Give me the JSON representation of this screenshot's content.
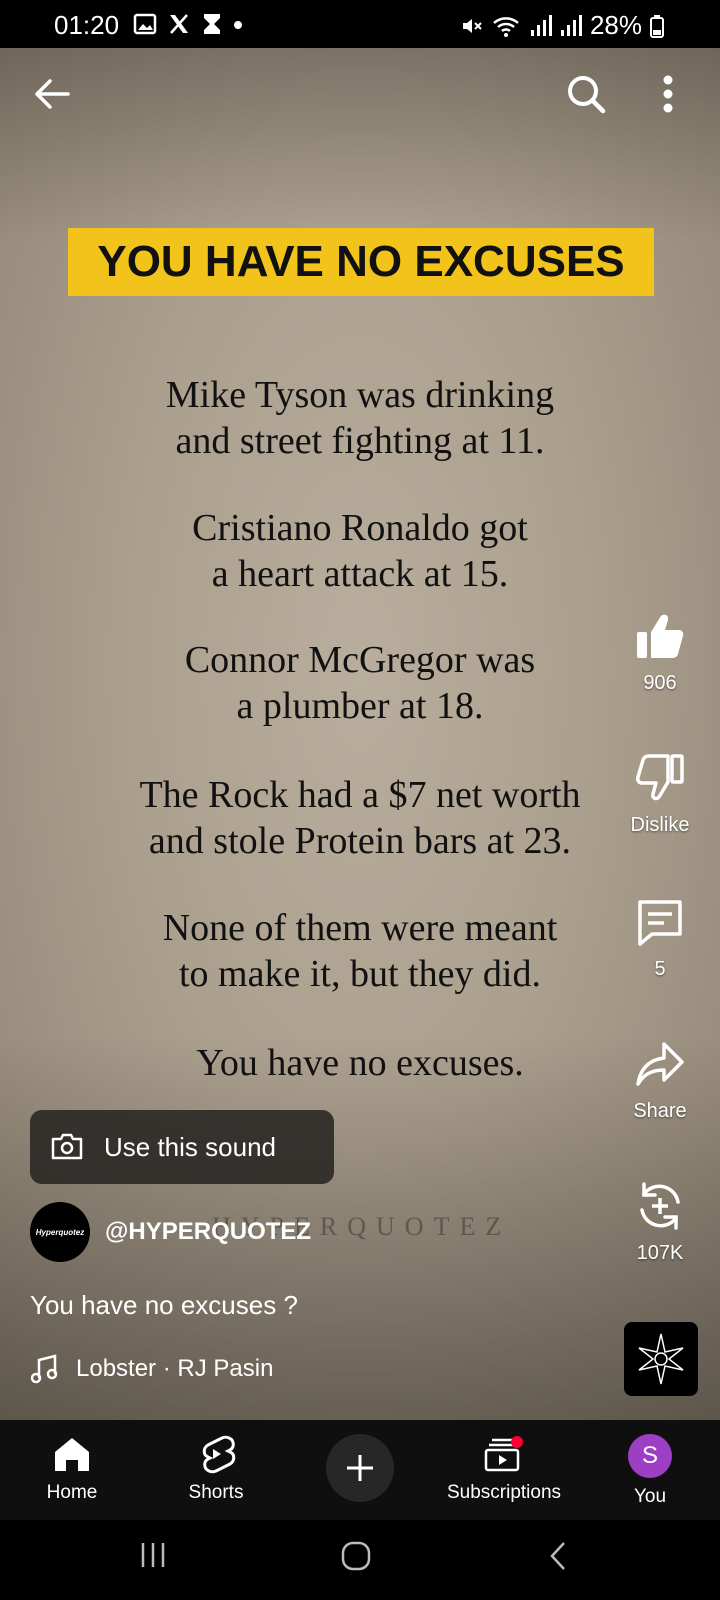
{
  "status_bar": {
    "time": "01:20",
    "battery": "28%"
  },
  "video": {
    "headline": "YOU HAVE NO EXCUSES",
    "quote_lines": [
      [
        "Mike Tyson was drinking",
        "and street fighting at 11."
      ],
      [
        "Cristiano Ronaldo got",
        "a heart attack at 15."
      ],
      [
        "Connor McGregor was",
        "a plumber at 18."
      ],
      [
        "The Rock had a $7 net worth",
        "and stole Protein bars at 23."
      ],
      [
        "None of them were meant",
        "to make it, but they did."
      ],
      [
        "You have no excuses."
      ]
    ],
    "watermark": "HYPERQUOTEZ"
  },
  "actions": {
    "like_count": "906",
    "dislike_label": "Dislike",
    "comment_count": "5",
    "share_label": "Share",
    "remix_count": "107K"
  },
  "sound_chip": {
    "label": "Use this sound"
  },
  "channel": {
    "avatar_text": "Hyperquotez",
    "handle": "@HYPERQUOTEZ"
  },
  "video_title": "You have no excuses ?",
  "music": {
    "label": "Lobster · RJ Pasin"
  },
  "bottom_nav": {
    "home": "Home",
    "shorts": "Shorts",
    "subscriptions": "Subscriptions",
    "you": "You",
    "you_initial": "S"
  },
  "colors": {
    "accent_yellow": "#f2c31b",
    "notification_red": "#ff0033",
    "avatar_purple": "#9c3fc4"
  }
}
